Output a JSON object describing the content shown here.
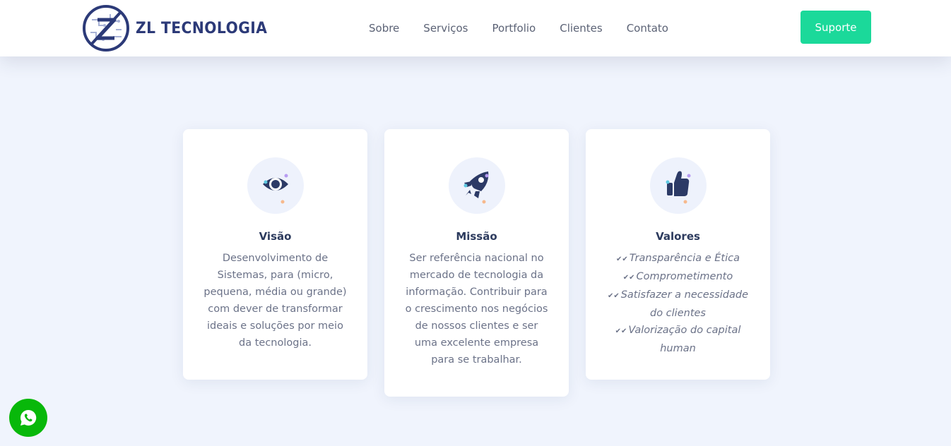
{
  "header": {
    "logo_text": "ZL TECNOLOGIA",
    "nav": [
      "Sobre",
      "Serviços",
      "Portfolio",
      "Clientes",
      "Contato"
    ],
    "support_button": "Suporte"
  },
  "cards": [
    {
      "icon": "eye-icon",
      "title": "Visão",
      "text": "Desenvolvimento de Sistemas, para (micro, pequena, média ou grande) com dever de transformar ideais e soluções por meio da tecnologia."
    },
    {
      "icon": "rocket-icon",
      "title": "Missão",
      "text": "Ser referência nacional no mercado de tecnologia da informação. Contribuir para o crescimento nos negócios de nossos clientes e ser uma excelente empresa para se trabalhar."
    },
    {
      "icon": "thumbs-up-icon",
      "title": "Valores",
      "values": [
        "Transparência e Ética",
        "Comprometimento",
        "Satisfazer a necessidade do clientes",
        "Valorização do capital human"
      ]
    }
  ],
  "floating": {
    "icon": "whatsapp-icon"
  },
  "colors": {
    "accent": "#1bd99a",
    "navy": "#2c3a78",
    "background": "#f0f4fd",
    "whatsapp": "#08b80a"
  }
}
